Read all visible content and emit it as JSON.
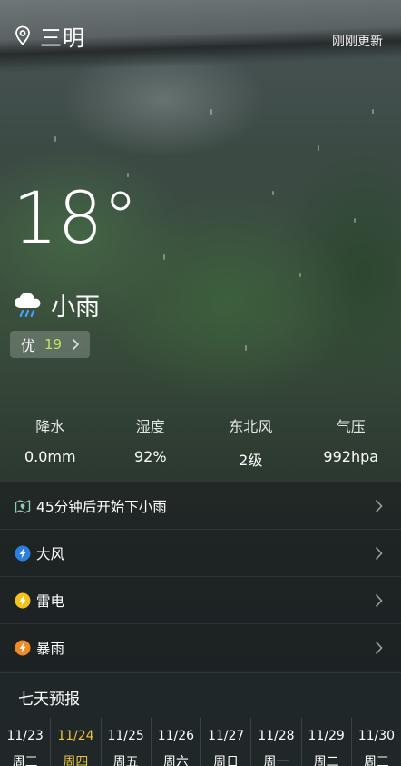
{
  "header": {
    "location_icon": "location-pin-icon",
    "city": "三明",
    "updated": "刚刚更新"
  },
  "current": {
    "temperature": "18°",
    "condition_icon": "cloud-rain-icon",
    "condition": "小雨",
    "aqi_level": "优",
    "aqi_value": "19"
  },
  "stats": [
    {
      "label": "降水",
      "value": "0.0mm"
    },
    {
      "label": "湿度",
      "value": "92%"
    },
    {
      "label": "东北风",
      "value": "2级"
    },
    {
      "label": "气压",
      "value": "992hpa"
    }
  ],
  "alerts": [
    {
      "icon": "rain-map-icon",
      "text": "45分钟后开始下小雨",
      "color": "#8fc9b8"
    },
    {
      "icon": "wind-bolt-icon",
      "text": "大风",
      "color": "#2a7fe0"
    },
    {
      "icon": "thunder-bolt-icon",
      "text": "雷电",
      "color": "#f3c21b"
    },
    {
      "icon": "storm-bolt-icon",
      "text": "暴雨",
      "color": "#f08a24"
    }
  ],
  "forecast": {
    "title": "七天预报",
    "days": [
      {
        "date": "11/23",
        "weekday": "周三"
      },
      {
        "date": "11/24",
        "weekday": "周四"
      },
      {
        "date": "11/25",
        "weekday": "周五"
      },
      {
        "date": "11/26",
        "weekday": "周六"
      },
      {
        "date": "11/27",
        "weekday": "周日"
      },
      {
        "date": "11/28",
        "weekday": "周一"
      },
      {
        "date": "11/29",
        "weekday": "周二"
      },
      {
        "date": "11/30",
        "weekday": "周三"
      }
    ],
    "selected_index": 1,
    "selected_color": "#e8c340"
  }
}
